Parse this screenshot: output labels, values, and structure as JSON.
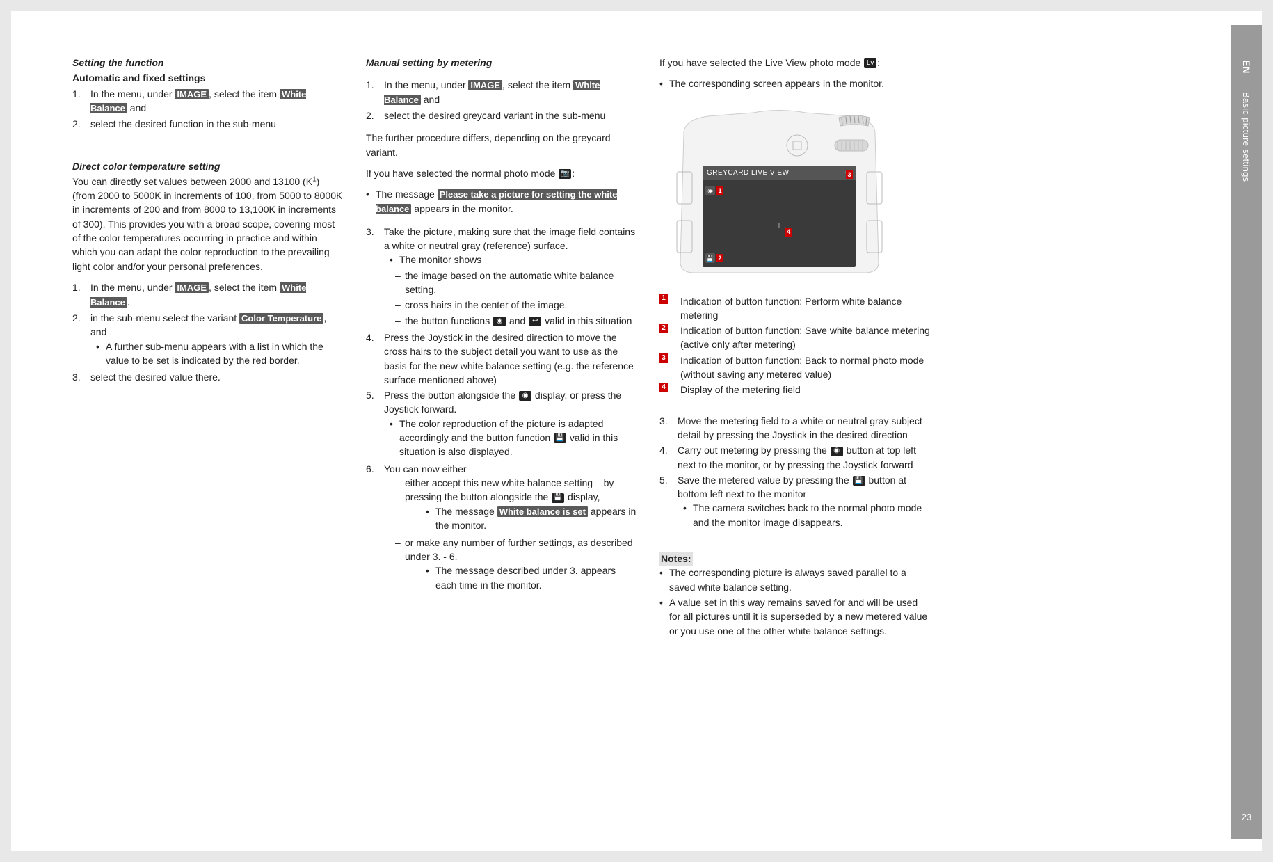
{
  "side": {
    "lang": "EN",
    "section": "Basic picture settings",
    "page": "23"
  },
  "col1": {
    "h1": "Setting the function",
    "h2": "Automatic and fixed settings",
    "l1_1a": "In the menu, under ",
    "l1_1b": ", select the item ",
    "l1_1c": " and",
    "l1_2": "select the desired function in the sub-menu",
    "h3": "Direct color temperature setting",
    "p1a": "You can directly set values between 2000 and 13100 (K",
    "p1b": ") (from 2000 to 5000K in increments of 100, from 5000 to 8000K in increments of 200 and from 8000 to 13,100K in increments of 300). This provides you with a broad scope, covering most of the color temperatures occurring in practice and within which you can adapt the color reproduction to the prevailing light color and/or your personal preferences.",
    "l2_1a": "In the menu, under ",
    "l2_1b": ", select the item ",
    "l2_1c": ".",
    "l2_2a": "in the sub-menu select the variant ",
    "l2_2b": ", and",
    "l2_2_b1a": "A further sub-menu appears with a list in which the value to be set is indicated by the red ",
    "l2_2_b1b": ".",
    "l2_3": "select the desired value there.",
    "inv_image": "IMAGE",
    "inv_wb": "White Balance",
    "inv_ct": "Color Temperature",
    "underline_border": "border",
    "sup1": "1"
  },
  "col2": {
    "h1": "Manual setting by metering",
    "l1_1a": "In the menu, under ",
    "l1_1b": ", select the item ",
    "l1_1c": " and",
    "l1_2": "select the desired greycard variant in the sub-menu",
    "p1": "The further procedure differs, depending on the greycard variant.",
    "p2a": "If you have selected the normal photo mode ",
    "p2b": ":",
    "b1a": "The message ",
    "b1b": " appears in the monitor.",
    "inv_msg": "Please take a picture for setting the white balance",
    "l3": "Take the picture, making sure that the image field contains a white or neutral gray (reference) surface.",
    "l3_b1": "The monitor shows",
    "l3_d1": "the image based on the automatic white balance setting,",
    "l3_d2": "cross hairs in the center of the image.",
    "l3_d3a": "the button functions ",
    "l3_d3b": " and ",
    "l3_d3c": " valid in this situation",
    "l4": "Press the Joystick in the desired direction to move the cross hairs to the subject detail you want to use as the basis for the new white balance setting (e.g. the reference surface mentioned above)",
    "l5a": "Press the button alongside the ",
    "l5b": " display, or press the Joystick forward.",
    "l5_b1a": "The color reproduction of the picture is adapted accordingly and the button function ",
    "l5_b1b": " valid in this situation is also displayed.",
    "l6": "You can now either",
    "l6_d1a": "either accept this new white balance setting – by pressing the button alongside the ",
    "l6_d1b": " display,",
    "l6_d1_b1a": "The message ",
    "l6_d1_b1b": " appears in the monitor.",
    "inv_set": "White balance is set",
    "l6_d2": "or make any number of further settings, as described under 3. - 6.",
    "l6_d2_b1": "The message described under 3. appears each time in the monitor.",
    "inv_image": "IMAGE",
    "inv_wb": "White Balance"
  },
  "col3": {
    "p1a": "If you have selected the Live View photo mode ",
    "p1b": ":",
    "b1": "The corresponding screen appears in the monitor.",
    "screen_title": "GREYCARD LIVE VIEW",
    "leg1": "Indication of button function: Perform white balance metering",
    "leg2": "Indication of button function: Save white balance metering (active only after metering)",
    "leg3": "Indication of button function: Back to normal photo mode (without saving any metered value)",
    "leg4": "Display of the metering field",
    "l3": "Move the metering field to a white or neutral gray subject detail by pressing the Joystick in the desired direction",
    "l4a": "Carry out metering  by pressing the ",
    "l4b": " button at top left next to the monitor, or by pressing the Joystick forward",
    "l5a": "Save the metered value by pressing the ",
    "l5b": " button at bottom left next to the monitor",
    "l5_b1": "The camera switches back to the normal photo mode and the monitor image disappears.",
    "notes": "Notes:",
    "n1": "The corresponding picture is always saved parallel to a saved white balance setting.",
    "n2": "A value set in this way remains saved for and will be used for all pictures until it is superseded by a new metered value or you use one of the other white balance settings."
  }
}
